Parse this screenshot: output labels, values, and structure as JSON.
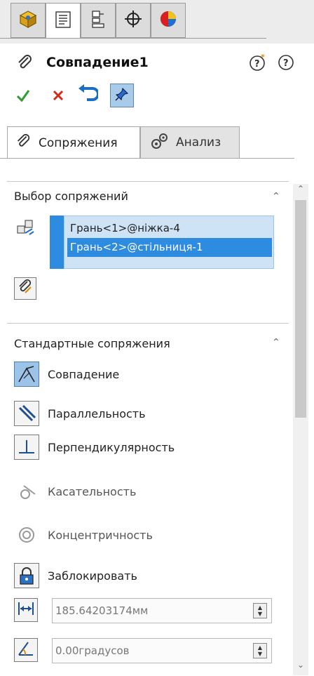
{
  "top_tabs": [
    {
      "icon": "feature-manager-icon",
      "active": false
    },
    {
      "icon": "property-manager-icon",
      "active": true
    },
    {
      "icon": "configuration-manager-icon",
      "active": false
    },
    {
      "icon": "dimxpert-manager-icon",
      "active": false
    },
    {
      "icon": "display-manager-icon",
      "active": false
    }
  ],
  "header": {
    "title": "Совпадение1"
  },
  "subtabs": {
    "mates": "Сопряжения",
    "analysis": "Анализ"
  },
  "mate_selections": {
    "title": "Выбор сопряжений",
    "items": [
      "Грань<1>@ніжка-4",
      "Грань<2>@стільниця-1"
    ],
    "selected_index": 1
  },
  "standard_mates": {
    "title": "Стандартные сопряжения",
    "options": [
      {
        "label": "Совпадение",
        "icon": "coincident-icon",
        "active": true
      },
      {
        "label": "Параллельность",
        "icon": "parallel-icon",
        "active": false
      },
      {
        "label": "Перпендикулярность",
        "icon": "perpendicular-icon",
        "active": false
      },
      {
        "label": "Касательность",
        "icon": "tangent-icon",
        "active": false,
        "disabled": true
      },
      {
        "label": "Концентричность",
        "icon": "concentric-icon",
        "active": false,
        "disabled": true
      },
      {
        "label": "Заблокировать",
        "icon": "lock-icon",
        "active": false
      }
    ],
    "distance_value": "185.64203174мм",
    "angle_value": "0.00градусов"
  },
  "colors": {
    "accent": "#2d8be0",
    "selection_bg": "#cfe3f7",
    "ok_green": "#2e9c2e",
    "cancel_red": "#d42a1a"
  }
}
